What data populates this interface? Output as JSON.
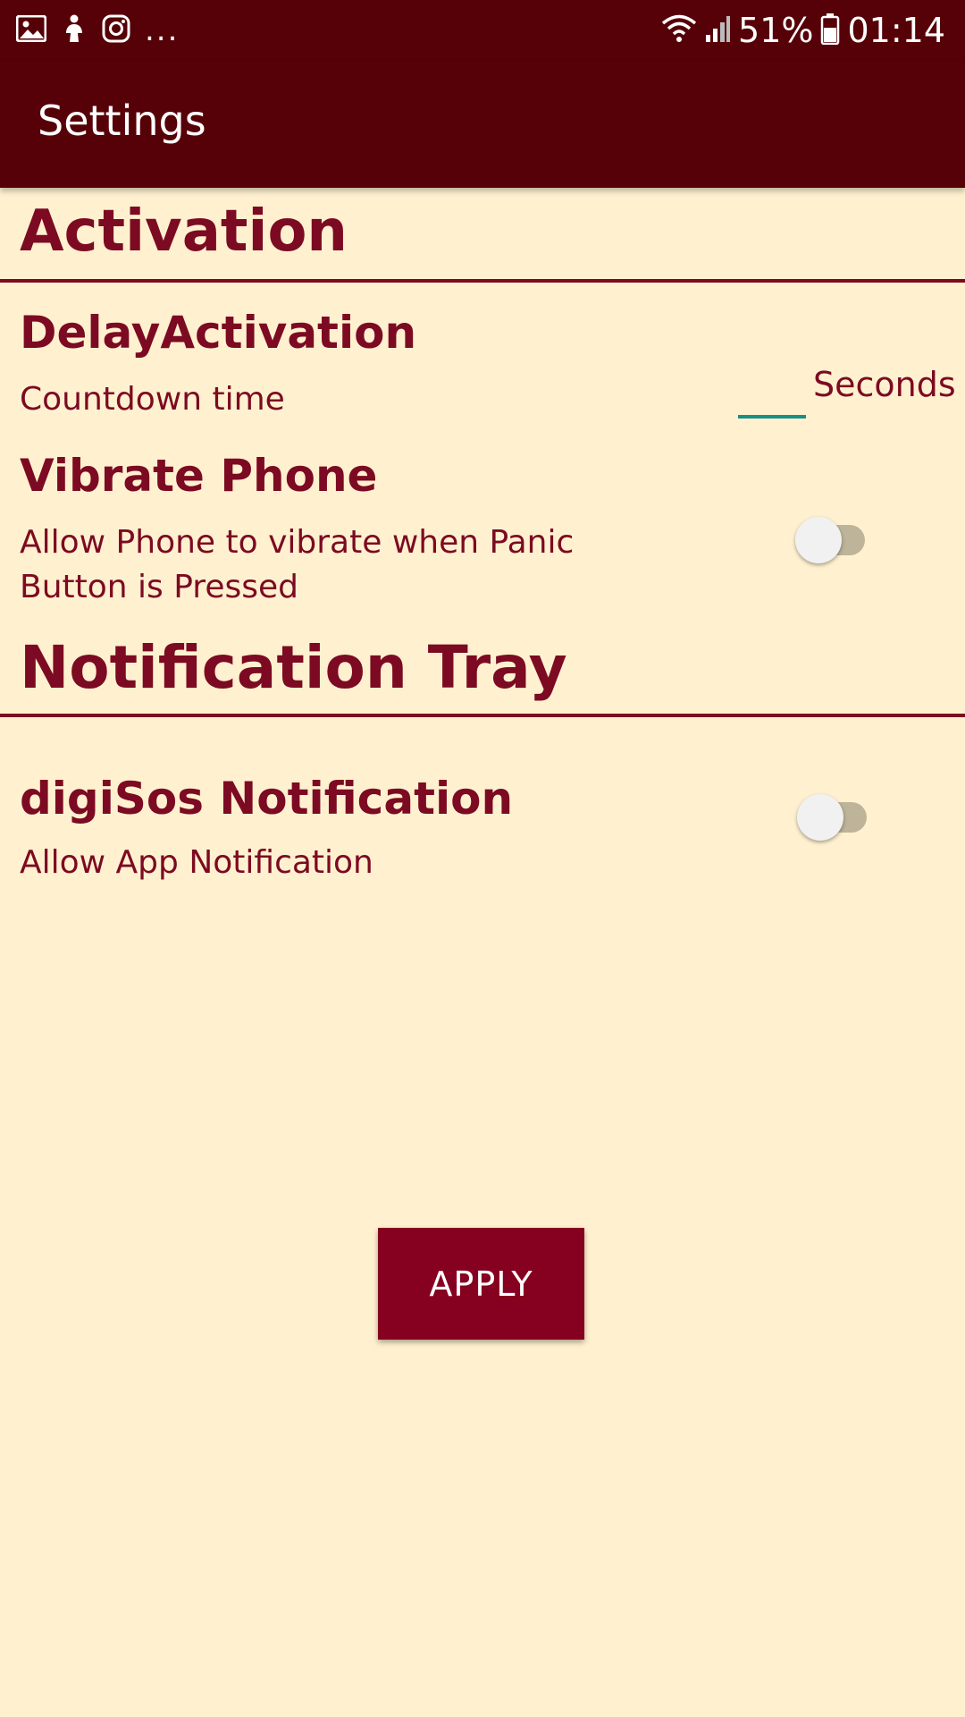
{
  "status_bar": {
    "icons_left": [
      "gallery-icon",
      "app-notification-icon",
      "instagram-icon"
    ],
    "overflow": "...",
    "battery_percent": "51%",
    "time": "01:14",
    "icons_right": [
      "wifi-icon",
      "signal-icon",
      "battery-icon"
    ]
  },
  "app_bar": {
    "title": "Settings"
  },
  "sections": {
    "activation": {
      "heading": "Activation",
      "delay": {
        "title": "DelayActivation",
        "summary": "Countdown time",
        "value": "",
        "unit": "Seconds"
      },
      "vibrate": {
        "title": "Vibrate Phone",
        "summary_line1": "Allow Phone to vibrate when Panic",
        "summary_line2": "Button is Pressed",
        "enabled": false
      }
    },
    "notification_tray": {
      "heading": "Notification Tray",
      "digisos": {
        "title": "digiSos Notification",
        "summary": "Allow App Notification",
        "enabled": false
      }
    }
  },
  "apply_button": {
    "label": "APPLY"
  },
  "colors": {
    "primary_dark": "#560007",
    "accent_text": "#7C0A22",
    "button": "#860020",
    "background": "#FFF1D0",
    "edit_underline": "#169185"
  }
}
